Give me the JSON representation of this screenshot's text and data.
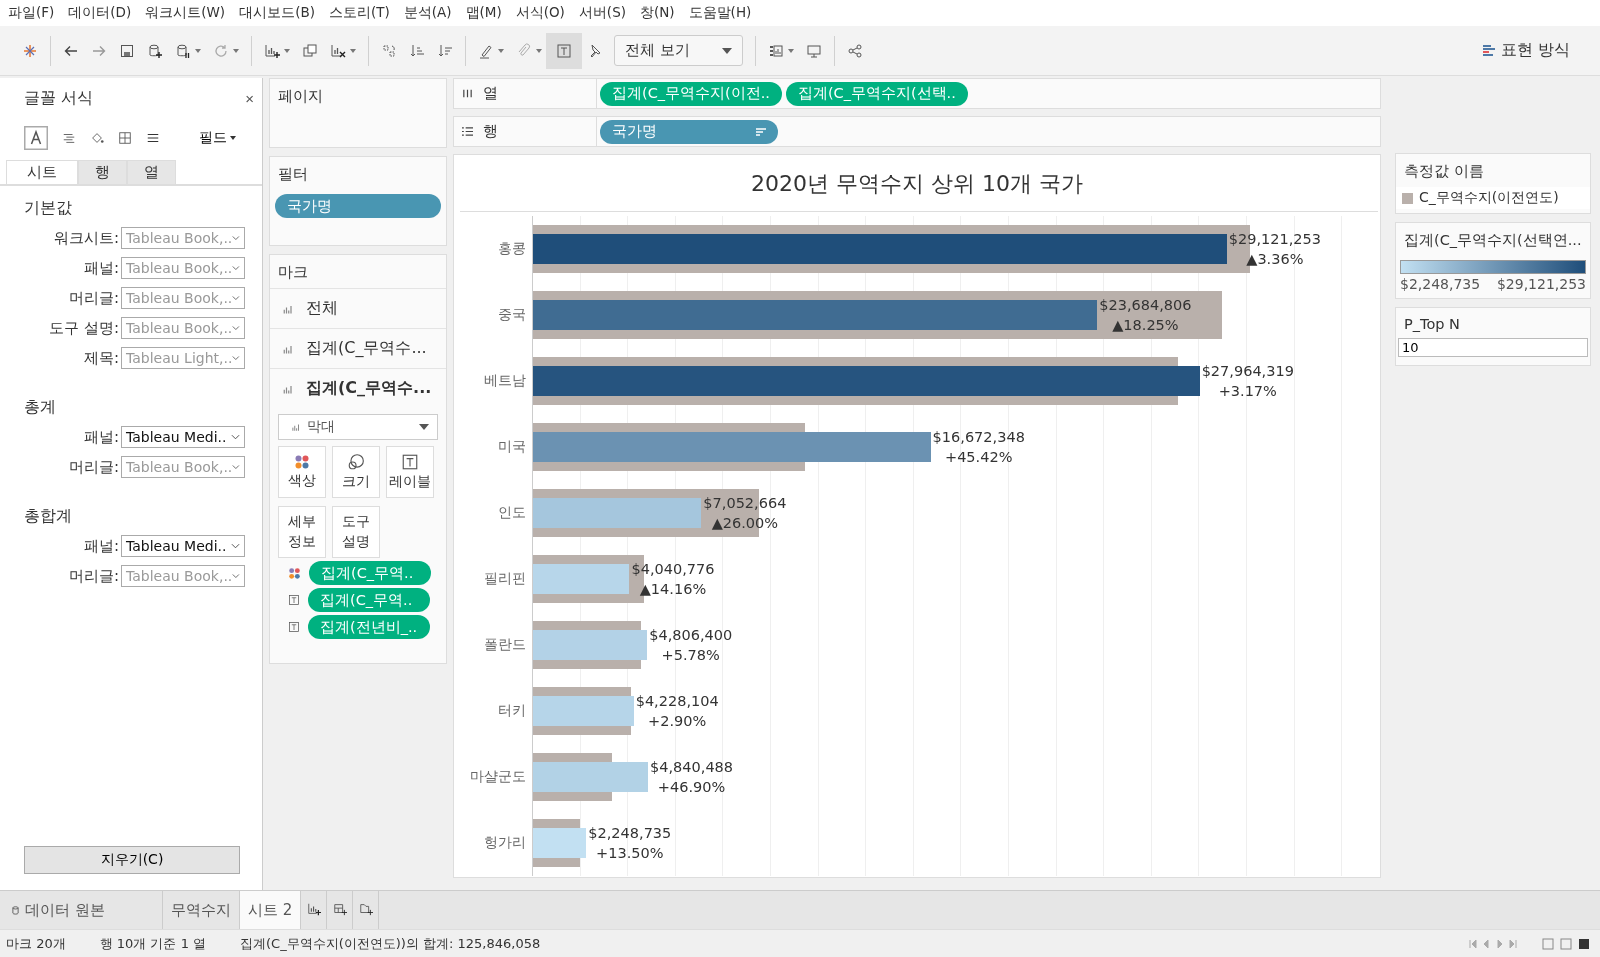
{
  "menu_bar": [
    "파일(F)",
    "데이터(D)",
    "워크시트(W)",
    "대시보드(B)",
    "스토리(T)",
    "분석(A)",
    "맵(M)",
    "서식(O)",
    "서버(S)",
    "창(N)",
    "도움말(H)"
  ],
  "toolbar": {
    "view_select": "전체 보기",
    "show_me": "표현 방식"
  },
  "format_panel": {
    "title": "글꼴 서식",
    "close": "×",
    "fields_button": "필드",
    "tabs": [
      {
        "label": "시트",
        "selected": true
      },
      {
        "label": "행",
        "selected": false
      },
      {
        "label": "열",
        "selected": false
      }
    ],
    "sections": [
      {
        "title": "기본값",
        "rows": [
          {
            "label": "워크시트:",
            "value": "Tableau Book,..",
            "greyed": true
          },
          {
            "label": "패널:",
            "value": "Tableau Book,..",
            "greyed": true
          },
          {
            "label": "머리글:",
            "value": "Tableau Book,..",
            "greyed": true
          },
          {
            "label": "도구 설명:",
            "value": "Tableau Book,..",
            "greyed": true
          },
          {
            "label": "제목:",
            "value": "Tableau Light,..",
            "greyed": true
          }
        ]
      },
      {
        "title": "총계",
        "rows": [
          {
            "label": "패널:",
            "value": "Tableau Medi..",
            "greyed": false
          },
          {
            "label": "머리글:",
            "value": "Tableau Book,..",
            "greyed": true
          }
        ]
      },
      {
        "title": "총합계",
        "rows": [
          {
            "label": "패널:",
            "value": "Tableau Medi..",
            "greyed": false
          },
          {
            "label": "머리글:",
            "value": "Tableau Book,..",
            "greyed": true
          }
        ]
      }
    ],
    "clear_button": "지우기(C)"
  },
  "pages": {
    "title": "페이지"
  },
  "filters": {
    "title": "필터",
    "pills": [
      "국가명"
    ]
  },
  "marks": {
    "title": "마크",
    "layers": [
      {
        "label": "전체",
        "selected": false
      },
      {
        "label": "집계(C_무역수...",
        "selected": false
      },
      {
        "label": "집계(C_무역수...",
        "selected": true
      }
    ],
    "mark_type": "막대",
    "cards": [
      {
        "kind": "color",
        "lines": [
          "색상"
        ]
      },
      {
        "kind": "size",
        "lines": [
          "크기"
        ]
      },
      {
        "kind": "label",
        "lines": [
          "레이블"
        ]
      },
      {
        "kind": "detail",
        "lines": [
          "세부",
          "정보"
        ]
      },
      {
        "kind": "tooltip",
        "lines": [
          "도구",
          "설명"
        ]
      }
    ],
    "fields": [
      {
        "kind": "color",
        "label": "집계(C_무역.."
      },
      {
        "kind": "label",
        "label": "집계(C_무역.."
      },
      {
        "kind": "label",
        "label": "집계(전년비_.."
      }
    ]
  },
  "shelves": [
    {
      "kind": "columns",
      "label": "열",
      "pills": [
        {
          "label": "집계(C_무역수지(이전..",
          "kind": "measure",
          "sorted": false
        },
        {
          "label": "집계(C_무역수지(선택..",
          "kind": "measure",
          "sorted": false
        }
      ]
    },
    {
      "kind": "rows",
      "label": "행",
      "pills": [
        {
          "label": "국가명",
          "kind": "dimension",
          "sorted": true
        }
      ]
    }
  ],
  "chart": {
    "title": "2020년 무역수지 상위 10개 국가",
    "rows": [
      {
        "label": "홍콩",
        "value": "$29,121,253",
        "change": "▲3.36%",
        "bars": [
          {
            "kind": "previous",
            "level": 0.847,
            "color": "#b9b0ab"
          },
          {
            "kind": "selected",
            "level": 0.82,
            "color": "#1f4e7a"
          }
        ]
      },
      {
        "label": "중국",
        "value": "$23,684,806",
        "change": "▲18.25%",
        "bars": [
          {
            "kind": "previous",
            "level": 0.814,
            "color": "#b9b0ab"
          },
          {
            "kind": "selected",
            "level": 0.667,
            "color": "#406c92"
          }
        ]
      },
      {
        "label": "베트남",
        "value": "$27,964,319",
        "change": "+3.17%",
        "bars": [
          {
            "kind": "previous",
            "level": 0.763,
            "color": "#b9b0ab"
          },
          {
            "kind": "selected",
            "level": 0.788,
            "color": "#26547f"
          }
        ]
      },
      {
        "label": "미국",
        "value": "$16,672,348",
        "change": "+45.42%",
        "bars": [
          {
            "kind": "previous",
            "level": 0.322,
            "color": "#b9b0ab"
          },
          {
            "kind": "selected",
            "level": 0.47,
            "color": "#6b92b2"
          }
        ]
      },
      {
        "label": "인도",
        "value": "$7,052,664",
        "change": "▲26.00%",
        "bars": [
          {
            "kind": "previous",
            "level": 0.267,
            "color": "#b9b0ab"
          },
          {
            "kind": "selected",
            "level": 0.199,
            "color": "#a5c6dd"
          }
        ]
      },
      {
        "label": "필리핀",
        "value": "$4,040,776",
        "change": "▲14.16%",
        "bars": [
          {
            "kind": "previous",
            "level": 0.131,
            "color": "#b9b0ab"
          },
          {
            "kind": "selected",
            "level": 0.114,
            "color": "#b7d6ea"
          }
        ]
      },
      {
        "label": "폴란드",
        "value": "$4,806,400",
        "change": "+5.78%",
        "bars": [
          {
            "kind": "previous",
            "level": 0.128,
            "color": "#b9b0ab"
          },
          {
            "kind": "selected",
            "level": 0.135,
            "color": "#b3d2e7"
          }
        ]
      },
      {
        "label": "터키",
        "value": "$4,228,104",
        "change": "+2.90%",
        "bars": [
          {
            "kind": "previous",
            "level": 0.116,
            "color": "#b9b0ab"
          },
          {
            "kind": "selected",
            "level": 0.119,
            "color": "#b6d5e9"
          }
        ]
      },
      {
        "label": "마샬군도",
        "value": "$4,840,488",
        "change": "+46.90%",
        "bars": [
          {
            "kind": "previous",
            "level": 0.093,
            "color": "#b9b0ab"
          },
          {
            "kind": "selected",
            "level": 0.136,
            "color": "#b2d2e6"
          }
        ]
      },
      {
        "label": "헝가리",
        "value": "$2,248,735",
        "change": "+13.50%",
        "bars": [
          {
            "kind": "previous",
            "level": 0.055,
            "color": "#b9b0ab"
          },
          {
            "kind": "selected",
            "level": 0.063,
            "color": "#c2e0f2"
          }
        ]
      }
    ]
  },
  "legends": [
    {
      "kind": "category",
      "title": "측정값 이름",
      "items": [
        {
          "label": "C_무역수지(이전연도)",
          "color": "#b9b0ab"
        }
      ]
    },
    {
      "kind": "gradient",
      "title": "집계(C_무역수지(선택연...",
      "min": "$2,248,735",
      "max": "$29,121,253"
    },
    {
      "kind": "parameter",
      "title": "P_Top N",
      "value": "10"
    }
  ],
  "sheet_tabs": {
    "data_source": "데이터 원본",
    "sheets": [
      {
        "label": "무역수지",
        "selected": false
      },
      {
        "label": "시트 2",
        "selected": true
      }
    ]
  },
  "status_bar": [
    "마크 20개",
    "행 10개 기준 1 열",
    "집계(C_무역수지(이전연도))의 합계: 125,846,058"
  ]
}
